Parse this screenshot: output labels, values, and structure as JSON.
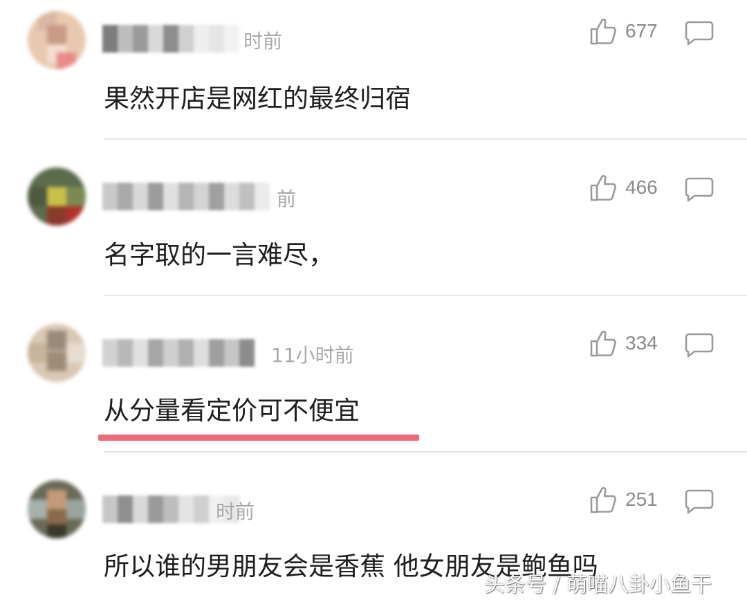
{
  "comments": [
    {
      "time": "时前",
      "likes": "677",
      "text": "果然开店是网红的最终归宿"
    },
    {
      "time": "前",
      "likes": "466",
      "text": "名字取的一言难尽，"
    },
    {
      "time": "11小时前",
      "likes": "334",
      "text": "从分量看定价可不便宜"
    },
    {
      "time": "时前",
      "likes": "251",
      "text": "所以谁的男朋友会是香蕉 他女朋友是鲍鱼吗"
    }
  ],
  "watermark": "头条号 / 萌喵八卦小鱼干",
  "colors": {
    "comment_text": "#1e1e1e",
    "meta_text": "#a8a8a8",
    "like_count": "#8a8a8a",
    "icon_stroke": "#9a9a9a",
    "highlight_underline": "#ef6c7a",
    "divider": "#e6e6e6"
  },
  "icons": {
    "like": "thumbs-up-icon",
    "reply": "speech-bubble-icon"
  }
}
